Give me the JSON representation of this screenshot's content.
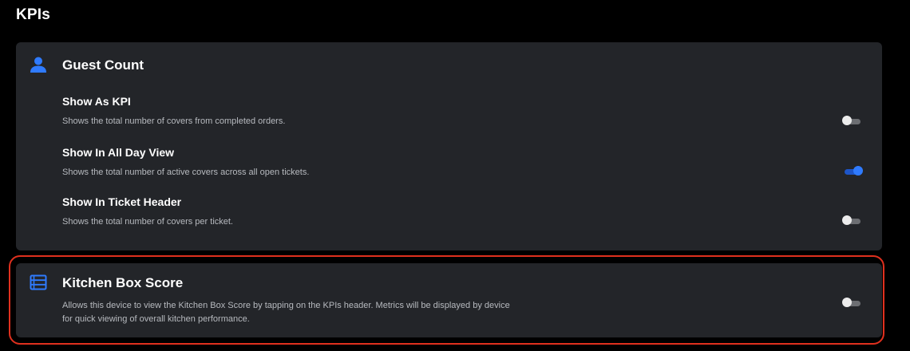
{
  "page": {
    "title": "KPIs"
  },
  "colors": {
    "accent": "#2f7bff",
    "highlight": "#e0301e",
    "card": "#232529"
  },
  "guest_count": {
    "icon": "person-icon",
    "title": "Guest Count",
    "settings": [
      {
        "title": "Show As KPI",
        "description": "Shows the total number of covers from completed orders.",
        "enabled": false
      },
      {
        "title": "Show In All Day View",
        "description": "Shows the total number of active covers across all open tickets.",
        "enabled": true
      },
      {
        "title": "Show In Ticket Header",
        "description": "Shows the total number of covers per ticket.",
        "enabled": false
      }
    ]
  },
  "kitchen_box_score": {
    "icon": "box-score-icon",
    "title": "Kitchen Box Score",
    "description_line1": "Allows this device to view the Kitchen Box Score by tapping on the KPIs header. Metrics will be displayed by device",
    "description_line2": "for quick viewing of overall kitchen performance.",
    "enabled": false
  }
}
